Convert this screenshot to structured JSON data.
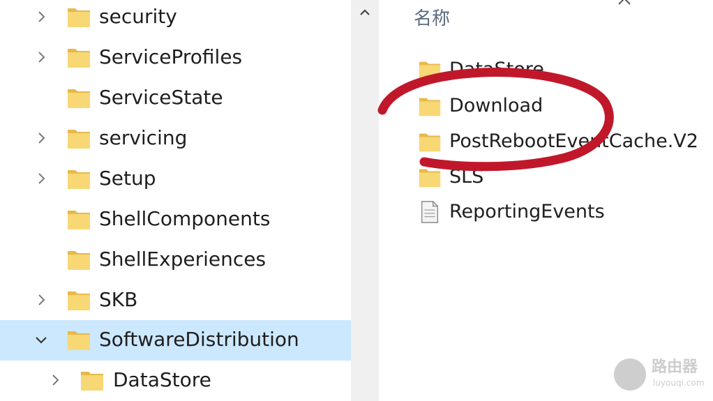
{
  "tree": {
    "items": [
      {
        "label": "security",
        "chevron": "right"
      },
      {
        "label": "ServiceProfiles",
        "chevron": "right"
      },
      {
        "label": "ServiceState",
        "chevron": "none"
      },
      {
        "label": "servicing",
        "chevron": "right"
      },
      {
        "label": "Setup",
        "chevron": "right"
      },
      {
        "label": "ShellComponents",
        "chevron": "none"
      },
      {
        "label": "ShellExperiences",
        "chevron": "none"
      },
      {
        "label": "SKB",
        "chevron": "right"
      },
      {
        "label": "SoftwareDistribution",
        "chevron": "down",
        "selected": true
      },
      {
        "label": "DataStore",
        "chevron": "right",
        "child": true
      }
    ]
  },
  "list": {
    "column_header": "名称",
    "items": [
      {
        "label": "DataStore",
        "type": "folder"
      },
      {
        "label": "Download",
        "type": "folder",
        "circled": true
      },
      {
        "label": "PostRebootEventCache.V2",
        "type": "folder"
      },
      {
        "label": "SLS",
        "type": "folder"
      },
      {
        "label": "ReportingEvents",
        "type": "file"
      }
    ]
  },
  "watermark": {
    "text": "路由器",
    "subtext": "luyouqi.com"
  },
  "colors": {
    "selection": "#cce8ff",
    "folder": "#f8d775",
    "folder_dark": "#e8b84a",
    "annotation": "#c0182a",
    "header_text": "#5a6b80"
  }
}
